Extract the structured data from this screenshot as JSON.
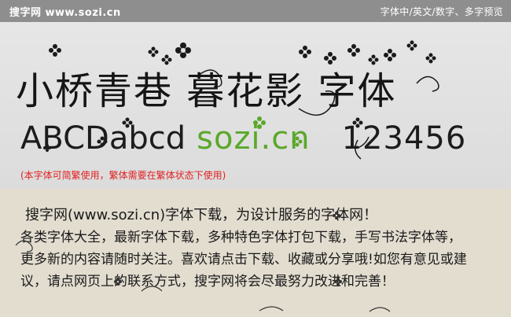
{
  "topbar": {
    "site_name": "搜字网 www.sozi.cn",
    "preview_modes": "字体中/英文/数字、多字预览"
  },
  "preview": {
    "title": "小桥青巷 暮花影 字体",
    "sample_latin": "ABCDabcd",
    "sample_url": "sozi.cn",
    "sample_digits": "123456",
    "notice": "(本字体可简繁使用，繁体需要在繁体状态下使用)"
  },
  "description": {
    "lines": [
      "搜字网(www.sozi.cn)字体下载，为设计服务的字体网！",
      "各类字体大全，最新字体下载，多种特色字体打包下载，手写书法字体等，",
      "更多新的内容请随时关注。喜欢请点击下载、收藏或分享哦!如您有意见或建",
      "议，请点网页上的联系方式，搜字网将会尽最努力改进和完善！"
    ]
  },
  "colors": {
    "topbar_bg": "#8e8e8e",
    "preview_bg": "#e3e3e3",
    "description_bg": "#e3ddd0",
    "url_green": "#5aa82a",
    "notice_red": "#e02020"
  }
}
